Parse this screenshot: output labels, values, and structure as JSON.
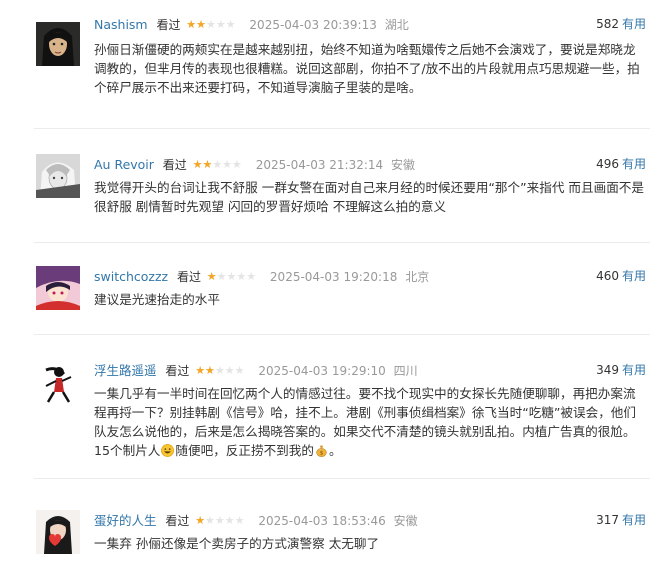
{
  "reviews": [
    {
      "author": "Nashism",
      "watched": "看过",
      "rating": 2,
      "time": "2025-04-03 20:39:13",
      "location": "湖北",
      "votes": "582",
      "useful_label": "有用",
      "content": "孙俪日渐僵硬的两颊实在是越来越别扭，始终不知道为啥甄嬛传之后她不会演戏了，要说是郑晓龙调教的，但芈月传的表现也很糟糕。说回这部剧，你拍不了/放不出的片段就用点巧思规避一些，拍个碎尸展示不出来还要打码，不知道导演脑子里装的是啥。",
      "avatar_icon": "dark-long-hair-portrait-avatar"
    },
    {
      "author": "Au Revoir",
      "watched": "看过",
      "rating": 2,
      "time": "2025-04-03 21:32:14",
      "location": "安徽",
      "votes": "496",
      "useful_label": "有用",
      "content": "我觉得开头的台词让我不舒服 一群女警在面对自己来月经的时候还要用“那个”来指代 而且画面不是很舒服 剧情暂时先观望 闪回的罗晋好烦哈 不理解这么拍的意义",
      "avatar_icon": "grayscale-anime-avatar"
    },
    {
      "author": "switchcozzz",
      "watched": "看过",
      "rating": 1,
      "time": "2025-04-03 19:20:18",
      "location": "北京",
      "votes": "460",
      "useful_label": "有用",
      "content": "建议是光速抬走的水平",
      "avatar_icon": "colorful-illustration-avatar"
    },
    {
      "author": "浮生路遥遥",
      "watched": "看过",
      "rating": 2,
      "time": "2025-04-03 19:29:10",
      "location": "四川",
      "votes": "349",
      "useful_label": "有用",
      "content_parts": [
        "一集几乎有一半时间在回忆两个人的情感过往。要不找个现实中的女探长先随便聊聊，再把办案流程再捋一下？别挂韩剧《信号》哈，挂不上。港剧《刑事侦缉档案》徐飞当时“吃糖”被误会，他们队友怎么说他的，后来是怎么揭晓答案的。如果交代不清楚的镜头就别乱拍。内植广告真的很尬。15个制片人",
        "随便吧，反正捞不到我的",
        "。"
      ],
      "avatar_icon": "running-figure-avatar"
    },
    {
      "author": "蛋好的人生",
      "watched": "看过",
      "rating": 1,
      "time": "2025-04-03 18:53:46",
      "location": "安徽",
      "votes": "317",
      "useful_label": "有用",
      "content": "一集弃 孙俪还像是个卖房子的方式演警察 太无聊了",
      "avatar_icon": "girl-with-red-heart-avatar"
    }
  ],
  "star_glyphs": "★★★★★",
  "colors": {
    "link": "#3377aa",
    "star": "#f5a623",
    "star_empty": "#e4e4e4",
    "meta": "#999999"
  }
}
